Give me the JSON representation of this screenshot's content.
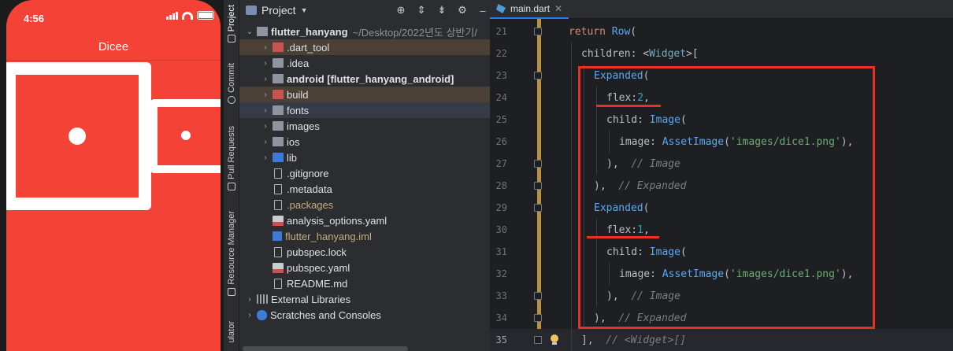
{
  "phone": {
    "time": "4:56",
    "app_title": "Dicee",
    "colors": {
      "background": "#f44336",
      "dice_border": "#ffffff"
    }
  },
  "tool_stripe": {
    "tabs": [
      {
        "label": "Project",
        "icon": "folder-icon",
        "active": true
      },
      {
        "label": "Commit",
        "icon": "commit-icon"
      },
      {
        "label": "Pull Requests",
        "icon": "pull-request-icon"
      },
      {
        "label": "Resource Manager",
        "icon": "resource-manager-icon"
      },
      {
        "label": "ulator",
        "icon": ""
      }
    ]
  },
  "project": {
    "title": "Project",
    "tree": [
      {
        "label": "flutter_hanyang",
        "suffix": "~/Desktop/2022년도 상반기/",
        "icon": "folder",
        "expanded": true,
        "depth": 0,
        "bold": true
      },
      {
        "label": ".dart_tool",
        "icon": "folder-red",
        "collapsed": true,
        "depth": 1,
        "excluded": true
      },
      {
        "label": ".idea",
        "icon": "folder",
        "collapsed": true,
        "depth": 1
      },
      {
        "label": "android [flutter_hanyang_android]",
        "icon": "folder",
        "collapsed": true,
        "depth": 1,
        "bold": true
      },
      {
        "label": "build",
        "icon": "folder-red",
        "collapsed": true,
        "depth": 1,
        "excluded": true
      },
      {
        "label": "fonts",
        "icon": "folder",
        "collapsed": true,
        "depth": 1,
        "selected": true
      },
      {
        "label": "images",
        "icon": "folder",
        "collapsed": true,
        "depth": 1
      },
      {
        "label": "ios",
        "icon": "folder",
        "collapsed": true,
        "depth": 1
      },
      {
        "label": "lib",
        "icon": "folder-blue",
        "collapsed": true,
        "depth": 1
      },
      {
        "label": ".gitignore",
        "icon": "file",
        "depth": 1
      },
      {
        "label": ".metadata",
        "icon": "file",
        "depth": 1
      },
      {
        "label": ".packages",
        "icon": "file",
        "depth": 1,
        "muted": true
      },
      {
        "label": "analysis_options.yaml",
        "icon": "yml",
        "depth": 1
      },
      {
        "label": "flutter_hanyang.iml",
        "icon": "iml",
        "depth": 1,
        "muted": true
      },
      {
        "label": "pubspec.lock",
        "icon": "file",
        "depth": 1
      },
      {
        "label": "pubspec.yaml",
        "icon": "yml",
        "depth": 1
      },
      {
        "label": "README.md",
        "icon": "file",
        "depth": 1
      },
      {
        "label": "External Libraries",
        "icon": "lib",
        "collapsed": true,
        "depth": 0
      },
      {
        "label": "Scratches and Consoles",
        "icon": "scratch",
        "collapsed": true,
        "depth": 0
      }
    ]
  },
  "editor": {
    "tab": {
      "label": "main.dart",
      "icon": "dart-icon"
    },
    "current_line": 35,
    "lines": [
      {
        "num": "21",
        "indent": 0,
        "tokens": [
          {
            "t": "return ",
            "c": "kw"
          },
          {
            "t": "Row",
            "c": "cls"
          },
          {
            "t": "(",
            "c": "punct"
          }
        ]
      },
      {
        "num": "22",
        "indent": 1,
        "tokens": [
          {
            "t": "children: <",
            "c": "punct"
          },
          {
            "t": "Widget",
            "c": "wid"
          },
          {
            "t": ">[",
            "c": "punct"
          }
        ]
      },
      {
        "num": "23",
        "indent": 2,
        "tokens": [
          {
            "t": "Expanded",
            "c": "cls"
          },
          {
            "t": "(",
            "c": "punct"
          }
        ]
      },
      {
        "num": "24",
        "indent": 3,
        "tokens": [
          {
            "t": "flex:",
            "c": "punct"
          },
          {
            "t": "2",
            "c": "num"
          },
          {
            "t": ",",
            "c": "punct"
          }
        ]
      },
      {
        "num": "25",
        "indent": 3,
        "tokens": [
          {
            "t": "child: ",
            "c": "punct"
          },
          {
            "t": "Image",
            "c": "cls"
          },
          {
            "t": "(",
            "c": "punct"
          }
        ]
      },
      {
        "num": "26",
        "indent": 4,
        "tokens": [
          {
            "t": "image: ",
            "c": "punct"
          },
          {
            "t": "AssetImage",
            "c": "cls"
          },
          {
            "t": "(",
            "c": "punct"
          },
          {
            "t": "'images/dice1.png'",
            "c": "str"
          },
          {
            "t": "),",
            "c": "punct"
          }
        ]
      },
      {
        "num": "27",
        "indent": 3,
        "tokens": [
          {
            "t": "),  ",
            "c": "punct"
          },
          {
            "t": "// Image",
            "c": "cmt"
          }
        ]
      },
      {
        "num": "28",
        "indent": 2,
        "tokens": [
          {
            "t": "),  ",
            "c": "punct"
          },
          {
            "t": "// Expanded",
            "c": "cmt"
          }
        ]
      },
      {
        "num": "29",
        "indent": 2,
        "tokens": [
          {
            "t": "Expanded",
            "c": "cls"
          },
          {
            "t": "(",
            "c": "punct"
          }
        ]
      },
      {
        "num": "30",
        "indent": 3,
        "tokens": [
          {
            "t": "flex:",
            "c": "punct"
          },
          {
            "t": "1",
            "c": "num"
          },
          {
            "t": ",",
            "c": "punct"
          }
        ]
      },
      {
        "num": "31",
        "indent": 3,
        "tokens": [
          {
            "t": "child: ",
            "c": "punct"
          },
          {
            "t": "Image",
            "c": "cls"
          },
          {
            "t": "(",
            "c": "punct"
          }
        ]
      },
      {
        "num": "32",
        "indent": 4,
        "tokens": [
          {
            "t": "image: ",
            "c": "punct"
          },
          {
            "t": "AssetImage",
            "c": "cls"
          },
          {
            "t": "(",
            "c": "punct"
          },
          {
            "t": "'images/dice1.png'",
            "c": "str"
          },
          {
            "t": "),",
            "c": "punct"
          }
        ]
      },
      {
        "num": "33",
        "indent": 3,
        "tokens": [
          {
            "t": "),  ",
            "c": "punct"
          },
          {
            "t": "// Image",
            "c": "cmt"
          }
        ]
      },
      {
        "num": "34",
        "indent": 2,
        "tokens": [
          {
            "t": "),  ",
            "c": "punct"
          },
          {
            "t": "// Expanded",
            "c": "cmt"
          }
        ]
      },
      {
        "num": "35",
        "indent": 1,
        "tokens": [
          {
            "t": "],",
            "c": "punct"
          },
          {
            "t": "  // <Widget>[]",
            "c": "cmt"
          }
        ]
      }
    ],
    "colors": {
      "annotation": "#e8321f",
      "change_marker": "#d3a449"
    }
  }
}
